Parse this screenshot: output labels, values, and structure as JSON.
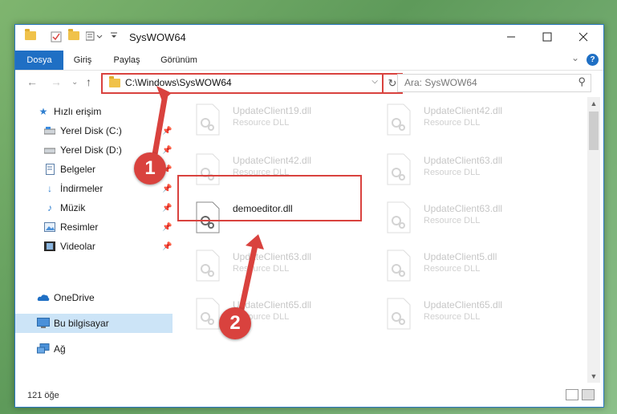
{
  "window": {
    "title": "SysWOW64"
  },
  "ribbon": {
    "tabs": [
      "Dosya",
      "Giriş",
      "Paylaş",
      "Görünüm"
    ],
    "help": "?"
  },
  "address": {
    "path": "C:\\Windows\\SysWOW64",
    "search_placeholder": "Ara: SysWOW64"
  },
  "sidebar": {
    "items": [
      {
        "label": "Hızlı erişim",
        "icon": "star-icon"
      },
      {
        "label": "Yerel Disk (C:)",
        "icon": "drive-icon",
        "pinned": true
      },
      {
        "label": "Yerel Disk (D:)",
        "icon": "drive-icon",
        "pinned": true
      },
      {
        "label": "Belgeler",
        "icon": "document-icon",
        "pinned": true
      },
      {
        "label": "İndirmeler",
        "icon": "download-icon",
        "pinned": true
      },
      {
        "label": "Müzik",
        "icon": "music-icon",
        "pinned": true
      },
      {
        "label": "Resimler",
        "icon": "pictures-icon",
        "pinned": true
      },
      {
        "label": "Videolar",
        "icon": "videos-icon",
        "pinned": true
      },
      {
        "label": "OneDrive",
        "icon": "cloud-icon"
      },
      {
        "label": "Bu bilgisayar",
        "icon": "computer-icon",
        "selected": true
      },
      {
        "label": "Ağ",
        "icon": "network-icon"
      }
    ]
  },
  "files": [
    {
      "name": "UpdateClient19.dll",
      "type": "Resource DLL"
    },
    {
      "name": "UpdateClient42.dll",
      "type": "Resource DLL"
    },
    {
      "name": "UpdateClient42.dll",
      "type": "Resource DLL"
    },
    {
      "name": "UpdateClient63.dll",
      "type": "Resource DLL"
    },
    {
      "name": "demoeditor.dll",
      "type": ""
    },
    {
      "name": "UpdateClient63.dll",
      "type": "Resource DLL"
    },
    {
      "name": "UpdateClient63.dll",
      "type": "Resource DLL"
    },
    {
      "name": "UpdateClient5.dll",
      "type": "Resource DLL"
    },
    {
      "name": "UpdateClient65.dll",
      "type": "Resource DLL"
    },
    {
      "name": "UpdateClient65.dll",
      "type": "Resource DLL"
    }
  ],
  "status": {
    "item_count": "121 öğe"
  },
  "annotations": {
    "step1": "1",
    "step2": "2"
  },
  "colors": {
    "accent": "#1f6fc4",
    "highlight": "#d9423e"
  }
}
